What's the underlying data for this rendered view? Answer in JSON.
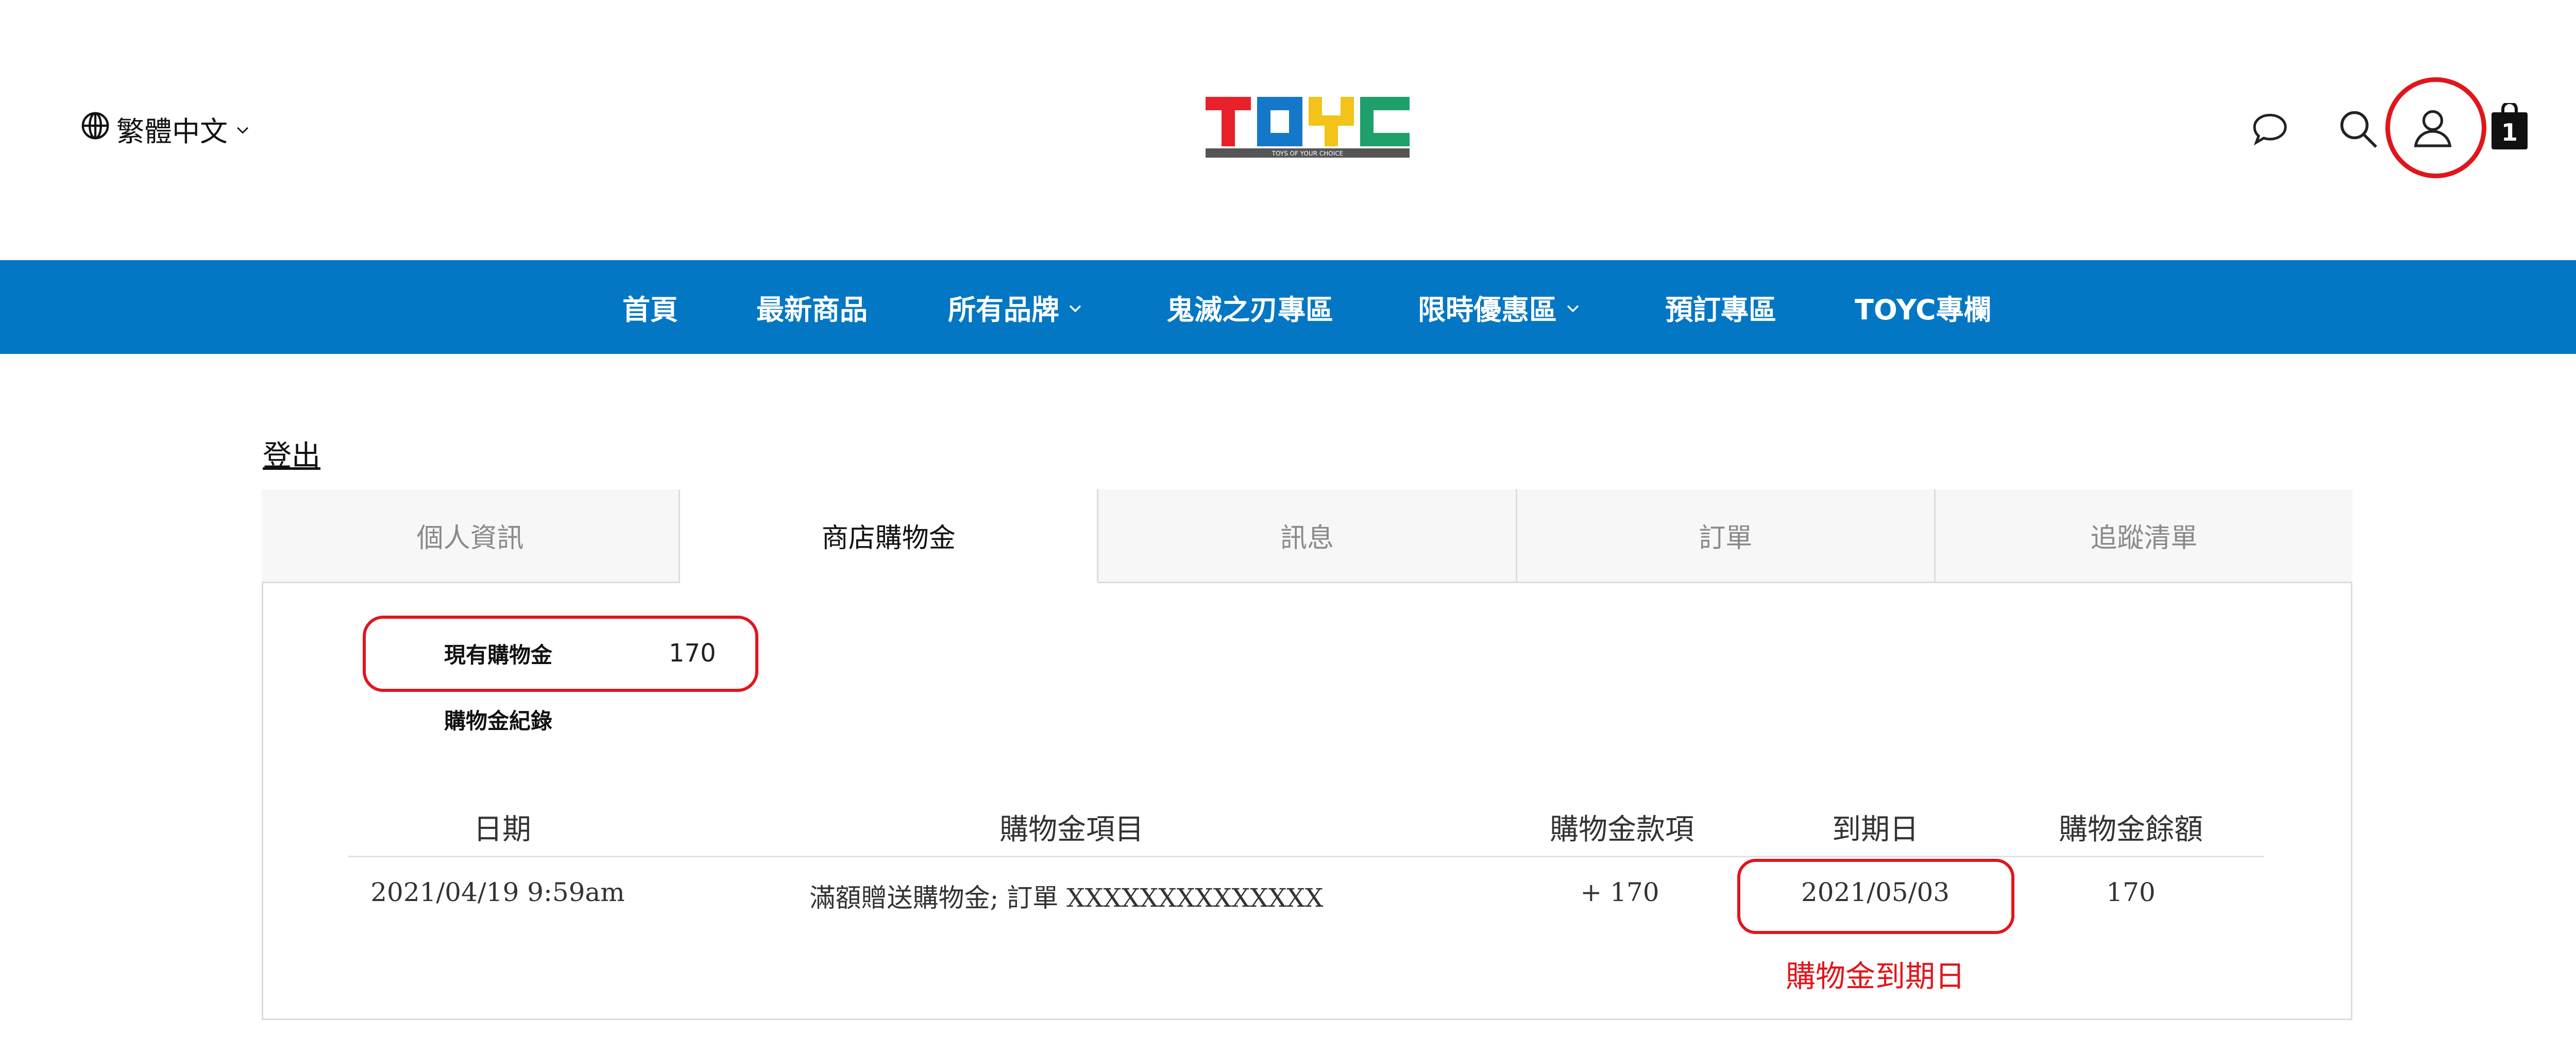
{
  "header": {
    "language": "繁體中文",
    "logo_text": "TOYC",
    "logo_tagline": "TOYS OF YOUR CHOICE",
    "cart_count": "1",
    "icons": [
      "globe-icon",
      "chevron-down-icon",
      "chat-icon",
      "search-icon",
      "user-icon",
      "shopping-bag-icon"
    ]
  },
  "nav": {
    "items": [
      {
        "label": "首頁",
        "dropdown": false
      },
      {
        "label": "最新商品",
        "dropdown": false
      },
      {
        "label": "所有品牌",
        "dropdown": true
      },
      {
        "label": "鬼滅之刃專區",
        "dropdown": false
      },
      {
        "label": "限時優惠區",
        "dropdown": true
      },
      {
        "label": "預訂專區",
        "dropdown": false
      },
      {
        "label": "TOYC專欄",
        "dropdown": false
      }
    ]
  },
  "account": {
    "logout": "登出",
    "tabs": [
      {
        "label": "個人資訊",
        "active": false
      },
      {
        "label": "商店購物金",
        "active": true
      },
      {
        "label": "訊息",
        "active": false
      },
      {
        "label": "訂單",
        "active": false
      },
      {
        "label": "追蹤清單",
        "active": false
      }
    ],
    "credit_label": "現有購物金",
    "credit_value": "170",
    "history_label": "購物金紀錄",
    "table": {
      "headers": [
        "日期",
        "購物金項目",
        "購物金款項",
        "到期日",
        "購物金餘額"
      ],
      "rows": [
        [
          "2021/04/19 9:59am",
          "滿額贈送購物金; 訂單  XXXXXXXXXXXXXX",
          "+ 170",
          "2021/05/03",
          "170"
        ]
      ]
    },
    "expiry_annotation": "購物金到期日"
  },
  "colors": {
    "nav_blue": "#0377c4",
    "highlight_red": "#e0161c",
    "logo_red": "#e8212a",
    "logo_blue": "#1577c8",
    "logo_yellow": "#f2c318",
    "logo_green": "#1fa06b"
  }
}
